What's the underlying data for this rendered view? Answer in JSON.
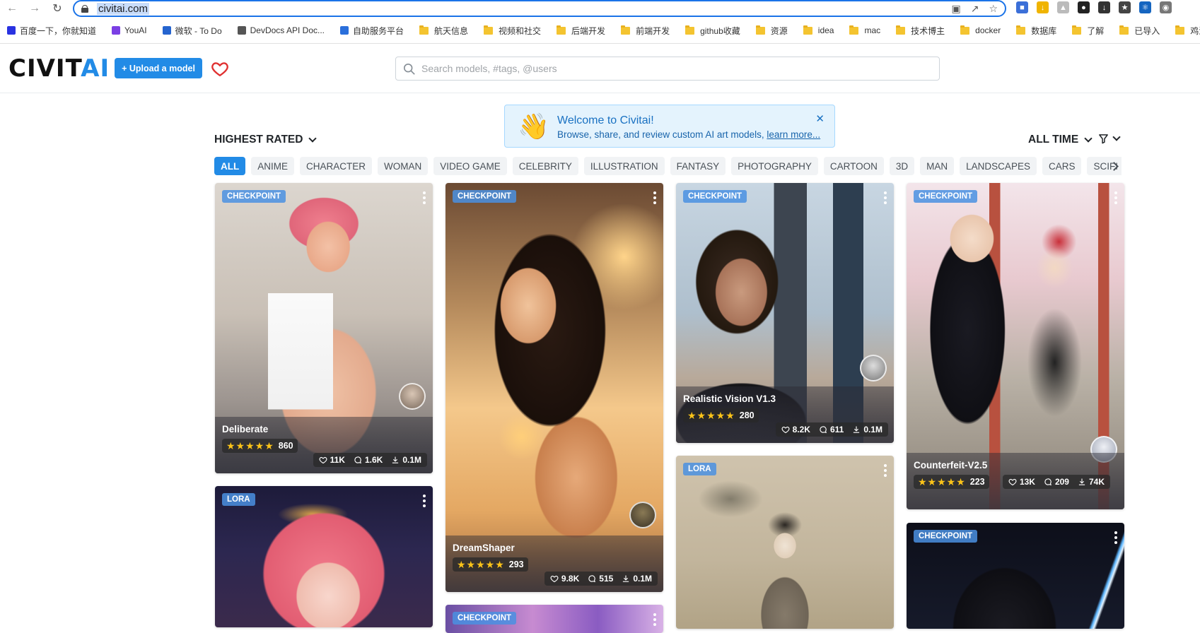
{
  "browser": {
    "url": "civitai.com",
    "bookmarks": [
      {
        "label": "百度一下，你就知道",
        "type": "site",
        "color": "#2932e1"
      },
      {
        "label": "YouAI",
        "type": "site",
        "color": "#7b3fe4"
      },
      {
        "label": "微软 - To Do",
        "type": "site",
        "color": "#2564cf"
      },
      {
        "label": "DevDocs API Doc...",
        "type": "site",
        "color": "#555555"
      },
      {
        "label": "自助服务平台",
        "type": "site",
        "color": "#2a6fdb"
      },
      {
        "label": "航天信息",
        "type": "folder"
      },
      {
        "label": "视频和社交",
        "type": "folder"
      },
      {
        "label": "后端开发",
        "type": "folder"
      },
      {
        "label": "前端开发",
        "type": "folder"
      },
      {
        "label": "github收藏",
        "type": "folder"
      },
      {
        "label": "资源",
        "type": "folder"
      },
      {
        "label": "idea",
        "type": "folder"
      },
      {
        "label": "mac",
        "type": "folder"
      },
      {
        "label": "技术博主",
        "type": "folder"
      },
      {
        "label": "docker",
        "type": "folder"
      },
      {
        "label": "数据库",
        "type": "folder"
      },
      {
        "label": "了解",
        "type": "folder"
      },
      {
        "label": "已导入",
        "type": "folder"
      },
      {
        "label": "鸡汤",
        "type": "folder"
      }
    ]
  },
  "header": {
    "logo_main": "CIVIT",
    "logo_accent": "AI",
    "upload_label": "+ Upload a model",
    "search_placeholder": "Search models, #tags, @users"
  },
  "welcome": {
    "title": "Welcome to Civitai!",
    "body": "Browse, share, and review custom AI art models, ",
    "link": "learn more..."
  },
  "controls": {
    "sort": "HIGHEST RATED",
    "period": "ALL TIME"
  },
  "tags": [
    "ALL",
    "ANIME",
    "CHARACTER",
    "WOMAN",
    "VIDEO GAME",
    "CELEBRITY",
    "ILLUSTRATION",
    "FANTASY",
    "PHOTOGRAPHY",
    "CARTOON",
    "3D",
    "MAN",
    "LANDSCAPES",
    "CARS",
    "SCIFI"
  ],
  "cards": [
    {
      "badge": "CHECKPOINT",
      "title": "Deliberate",
      "rating": "860",
      "likes": "11K",
      "comments": "1.6K",
      "downloads": "0.1M",
      "stars": 5
    },
    {
      "badge": "CHECKPOINT",
      "title": "DreamShaper",
      "rating": "293",
      "likes": "9.8K",
      "comments": "515",
      "downloads": "0.1M",
      "stars": 5
    },
    {
      "badge": "CHECKPOINT",
      "title": "Realistic Vision V1.3",
      "rating": "280",
      "likes": "8.2K",
      "comments": "611",
      "downloads": "0.1M",
      "stars": 5
    },
    {
      "badge": "CHECKPOINT",
      "title": "Counterfeit-V2.5",
      "rating": "223",
      "likes": "13K",
      "comments": "209",
      "downloads": "74K",
      "stars": 5
    },
    {
      "badge": "LORA"
    },
    {
      "badge": "LORA"
    },
    {
      "badge": "CHECKPOINT"
    },
    {
      "badge": "CHECKPOINT"
    }
  ],
  "colors": {
    "brand": "#228be6",
    "star": "#fcc419",
    "alert_bg": "#e4f3fd"
  }
}
